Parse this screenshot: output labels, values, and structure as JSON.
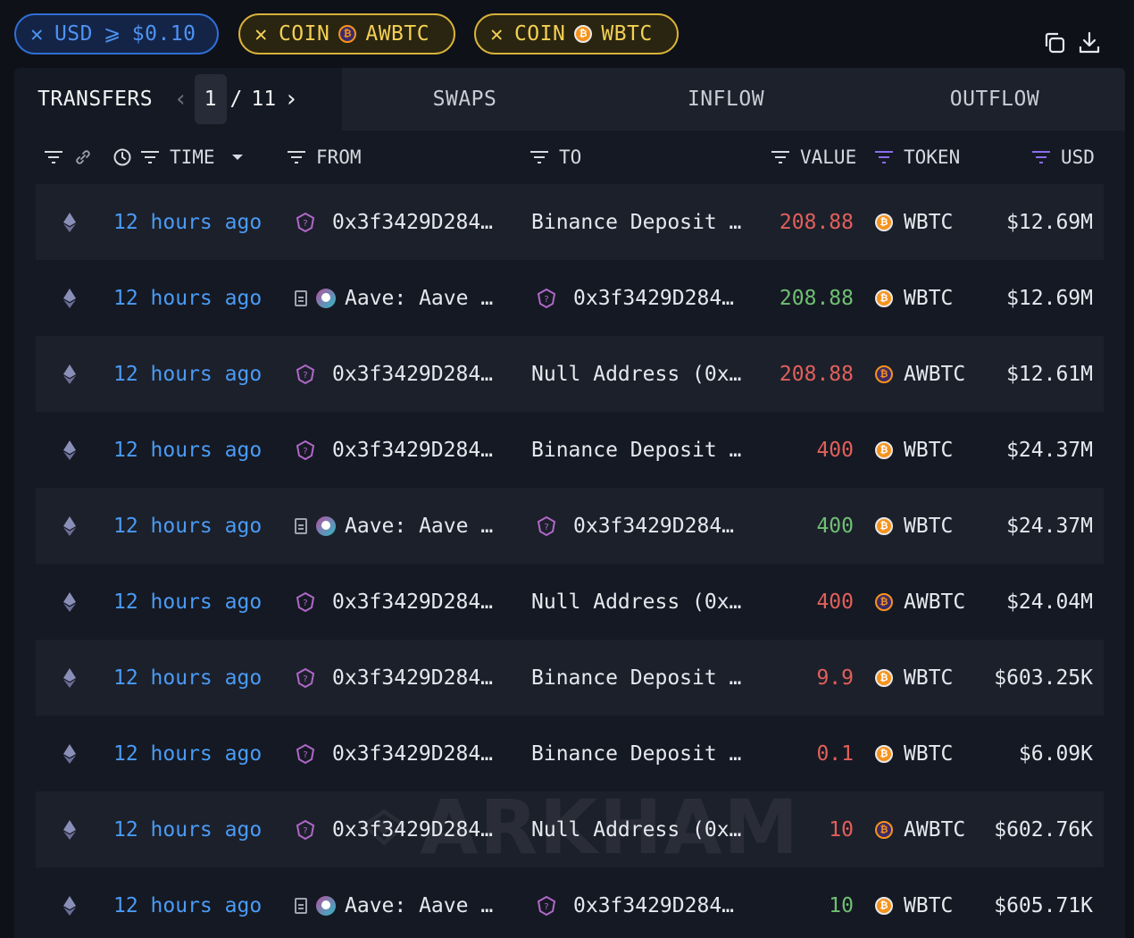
{
  "filters": {
    "usd": {
      "field": "USD",
      "op": "⩾",
      "value": "$0.10"
    },
    "coin1": {
      "field": "COIN",
      "token": "AWBTC"
    },
    "coin2": {
      "field": "COIN",
      "token": "WBTC"
    },
    "remove_glyph": "✕"
  },
  "tabs": {
    "transfers": "TRANSFERS",
    "page_current": "1",
    "page_sep": "/",
    "page_total": "11",
    "swaps": "SWAPS",
    "inflow": "INFLOW",
    "outflow": "OUTFLOW"
  },
  "columns": {
    "time": "TIME",
    "from": "FROM",
    "to": "TO",
    "value": "VALUE",
    "token": "TOKEN",
    "usd": "USD"
  },
  "colors": {
    "out_value": "#e0605a",
    "in_value": "#6fbf73",
    "time_link": "#4a9bf5",
    "accent_filter": "#8b6cf0"
  },
  "watermark": "ARKHAM",
  "rows": [
    {
      "time": "12 hours ago",
      "from": "0x3f3429D284…",
      "from_type": "addr",
      "to": "Binance Deposit …",
      "to_type": "plain",
      "value": "208.88",
      "dir": "out",
      "token": "WBTC",
      "usd": "$12.69M"
    },
    {
      "time": "12 hours ago",
      "from": "Aave: Aave …",
      "from_type": "aave",
      "to": "0x3f3429D284…",
      "to_type": "addr",
      "value": "208.88",
      "dir": "in",
      "token": "WBTC",
      "usd": "$12.69M"
    },
    {
      "time": "12 hours ago",
      "from": "0x3f3429D284…",
      "from_type": "addr",
      "to": "Null Address (0x…",
      "to_type": "plain",
      "value": "208.88",
      "dir": "out",
      "token": "AWBTC",
      "usd": "$12.61M"
    },
    {
      "time": "12 hours ago",
      "from": "0x3f3429D284…",
      "from_type": "addr",
      "to": "Binance Deposit …",
      "to_type": "plain",
      "value": "400",
      "dir": "out",
      "token": "WBTC",
      "usd": "$24.37M"
    },
    {
      "time": "12 hours ago",
      "from": "Aave: Aave …",
      "from_type": "aave",
      "to": "0x3f3429D284…",
      "to_type": "addr",
      "value": "400",
      "dir": "in",
      "token": "WBTC",
      "usd": "$24.37M"
    },
    {
      "time": "12 hours ago",
      "from": "0x3f3429D284…",
      "from_type": "addr",
      "to": "Null Address (0x…",
      "to_type": "plain",
      "value": "400",
      "dir": "out",
      "token": "AWBTC",
      "usd": "$24.04M"
    },
    {
      "time": "12 hours ago",
      "from": "0x3f3429D284…",
      "from_type": "addr",
      "to": "Binance Deposit …",
      "to_type": "plain",
      "value": "9.9",
      "dir": "out",
      "token": "WBTC",
      "usd": "$603.25K"
    },
    {
      "time": "12 hours ago",
      "from": "0x3f3429D284…",
      "from_type": "addr",
      "to": "Binance Deposit …",
      "to_type": "plain",
      "value": "0.1",
      "dir": "out",
      "token": "WBTC",
      "usd": "$6.09K"
    },
    {
      "time": "12 hours ago",
      "from": "0x3f3429D284…",
      "from_type": "addr",
      "to": "Null Address (0x…",
      "to_type": "plain",
      "value": "10",
      "dir": "out",
      "token": "AWBTC",
      "usd": "$602.76K"
    },
    {
      "time": "12 hours ago",
      "from": "Aave: Aave …",
      "from_type": "aave",
      "to": "0x3f3429D284…",
      "to_type": "addr",
      "value": "10",
      "dir": "in",
      "token": "WBTC",
      "usd": "$605.71K"
    }
  ]
}
